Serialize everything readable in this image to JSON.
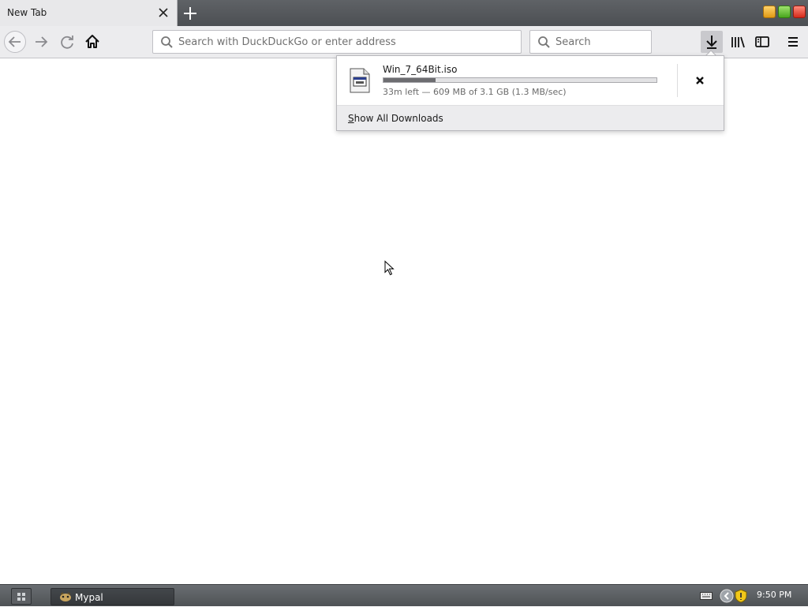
{
  "tab": {
    "title": "New Tab"
  },
  "toolbar": {
    "url_placeholder": "Search with DuckDuckGo or enter address",
    "search_placeholder": "Search"
  },
  "downloads": {
    "file_name": "Win_7_64Bit.iso",
    "status": "33m left — 609 MB of 3.1 GB (1.3 MB/sec)",
    "progress_fraction": 0.19,
    "show_all_prefix": "S",
    "show_all_rest": "how All Downloads"
  },
  "taskbar": {
    "app_label": "Mypal",
    "clock": "9:50 PM"
  },
  "icons": {
    "tab_close": "close-icon",
    "new_tab": "plus-icon",
    "back": "arrow-left-icon",
    "forward": "arrow-right-icon",
    "reload": "reload-icon",
    "home": "home-icon",
    "search": "magnifier-icon",
    "downloads": "download-arrow-icon",
    "library": "library-icon",
    "sidebar": "sidebar-icon",
    "menu": "hamburger-icon",
    "file": "iso-file-icon",
    "cancel": "close-icon"
  },
  "colors": {
    "tabstrip": "#4c4f53",
    "toolbar": "#ececee",
    "progress_fill": "#6d6d71",
    "taskbar": "#4e5255"
  }
}
